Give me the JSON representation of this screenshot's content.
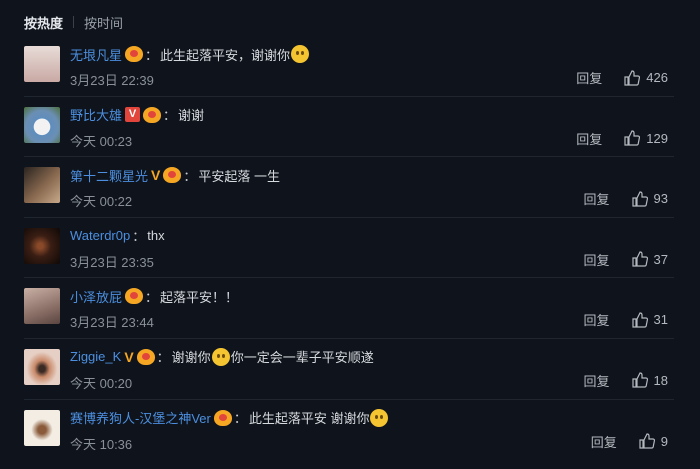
{
  "tabs": {
    "hot": "按热度",
    "time": "按时间"
  },
  "reply_label": "回复",
  "colors": {
    "username": "#4c8fe0",
    "vip": "#f5a623",
    "background": "#0f141c"
  },
  "comments": [
    {
      "user": "无垠凡星",
      "vip": false,
      "text": "此生起落平安，谢谢你",
      "emoji_after": true,
      "time": "3月23日 22:39",
      "likes": "426",
      "avatar_color": "#d8c7c4"
    },
    {
      "user": "野比大雄",
      "vip": true,
      "vip_style": "box",
      "text": "谢谢",
      "emoji_after": false,
      "time": "今天 00:23",
      "likes": "129",
      "avatar_color": "#6b8fb4"
    },
    {
      "user": "第十二颗星光",
      "vip": true,
      "text": "平安起落 一生",
      "emoji_after": false,
      "time": "今天 00:22",
      "likes": "93",
      "avatar_color": "#7a6a58"
    },
    {
      "user": "Waterdr0p",
      "vip": false,
      "no_badge": true,
      "text": "thx",
      "emoji_after": false,
      "time": "3月23日 23:35",
      "likes": "37",
      "avatar_color": "#3a1e14"
    },
    {
      "user": "小泽放屁",
      "vip": false,
      "text": "起落平安！！",
      "emoji_after": false,
      "time": "3月23日 23:44",
      "likes": "31",
      "avatar_color": "#a58c84"
    },
    {
      "user": "Ziggie_K",
      "vip": true,
      "text": "谢谢你",
      "emoji_mid": true,
      "text2": "你一定会一辈子平安顺遂",
      "time": "今天 00:20",
      "likes": "18",
      "avatar_color": "#c9b2a8"
    },
    {
      "user": "赛博养狗人-汉堡之神Ver",
      "vip": false,
      "text": "此生起落平安 谢谢你",
      "emoji_after": true,
      "time": "今天 10:36",
      "likes": "9",
      "avatar_color": "#efe8dc"
    }
  ]
}
